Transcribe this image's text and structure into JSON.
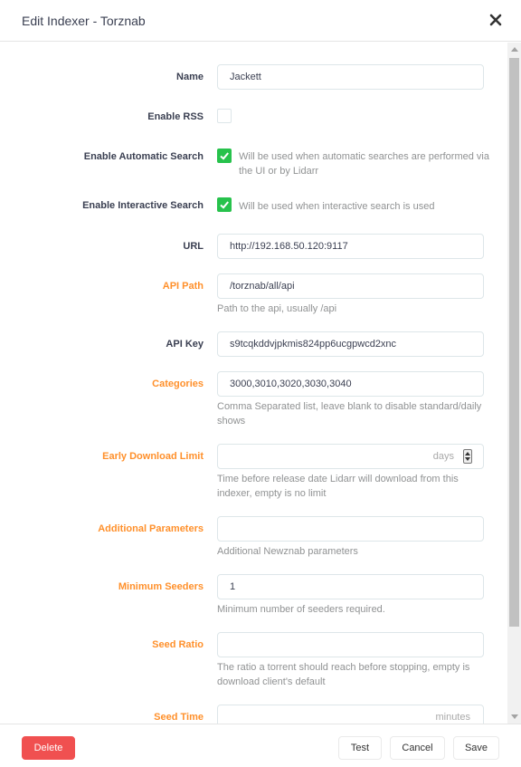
{
  "modal": {
    "title": "Edit Indexer - Torznab"
  },
  "fields": {
    "name": {
      "label": "Name",
      "value": "Jackett"
    },
    "enable_rss": {
      "label": "Enable RSS",
      "checked": false
    },
    "enable_automatic_search": {
      "label": "Enable Automatic Search",
      "checked": true,
      "help": "Will be used when automatic searches are performed via the UI or by Lidarr"
    },
    "enable_interactive_search": {
      "label": "Enable Interactive Search",
      "checked": true,
      "help": "Will be used when interactive search is used"
    },
    "url": {
      "label": "URL",
      "value": "http://192.168.50.120:9117"
    },
    "api_path": {
      "label": "API Path",
      "value": "/torznab/all/api",
      "help": "Path to the api, usually /api"
    },
    "api_key": {
      "label": "API Key",
      "value": "s9tcqkddvjpkmis824pp6ucgpwcd2xnc"
    },
    "categories": {
      "label": "Categories",
      "value": "3000,3010,3020,3030,3040",
      "help": "Comma Separated list, leave blank to disable standard/daily shows"
    },
    "early_download_limit": {
      "label": "Early Download Limit",
      "value": "",
      "unit": "days",
      "help": "Time before release date Lidarr will download from this indexer, empty is no limit"
    },
    "additional_parameters": {
      "label": "Additional Parameters",
      "value": "",
      "help": "Additional Newznab parameters"
    },
    "minimum_seeders": {
      "label": "Minimum Seeders",
      "value": "1",
      "help": "Minimum number of seeders required."
    },
    "seed_ratio": {
      "label": "Seed Ratio",
      "value": "",
      "help": "The ratio a torrent should reach before stopping, empty is download client's default"
    },
    "seed_time": {
      "label": "Seed Time",
      "value": "",
      "unit": "minutes"
    }
  },
  "footer": {
    "delete_label": "Delete",
    "test_label": "Test",
    "cancel_label": "Cancel",
    "save_label": "Save"
  },
  "colors": {
    "advanced_label": "#ff902b",
    "checkbox_on": "#27c24c",
    "danger": "#f05050"
  },
  "icons": {
    "close": "close-icon",
    "check": "check-icon"
  }
}
